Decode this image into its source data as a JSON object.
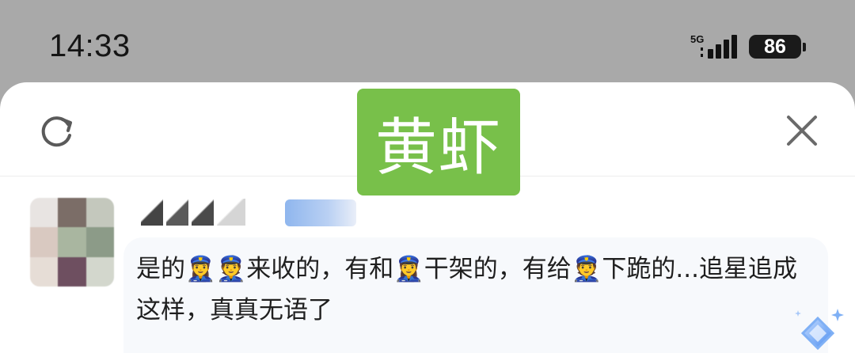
{
  "status_bar": {
    "time": "14:33",
    "network": "5G",
    "battery": "86"
  },
  "header": {
    "logo_text": "黄虾",
    "logo_color": "#78c04a",
    "refresh_icon": "refresh-icon",
    "close_icon": "close-icon"
  },
  "comment": {
    "text": "是的👮‍♀️👮来收的，有和👮‍♀️干架的，有给👮下跪的...追星追成这样，真真无语了"
  },
  "colors": {
    "sheet": "#ffffff",
    "backdrop": "#a9a9a9",
    "bubble": "#f7f9fc",
    "badge": "#8fb6ee"
  }
}
